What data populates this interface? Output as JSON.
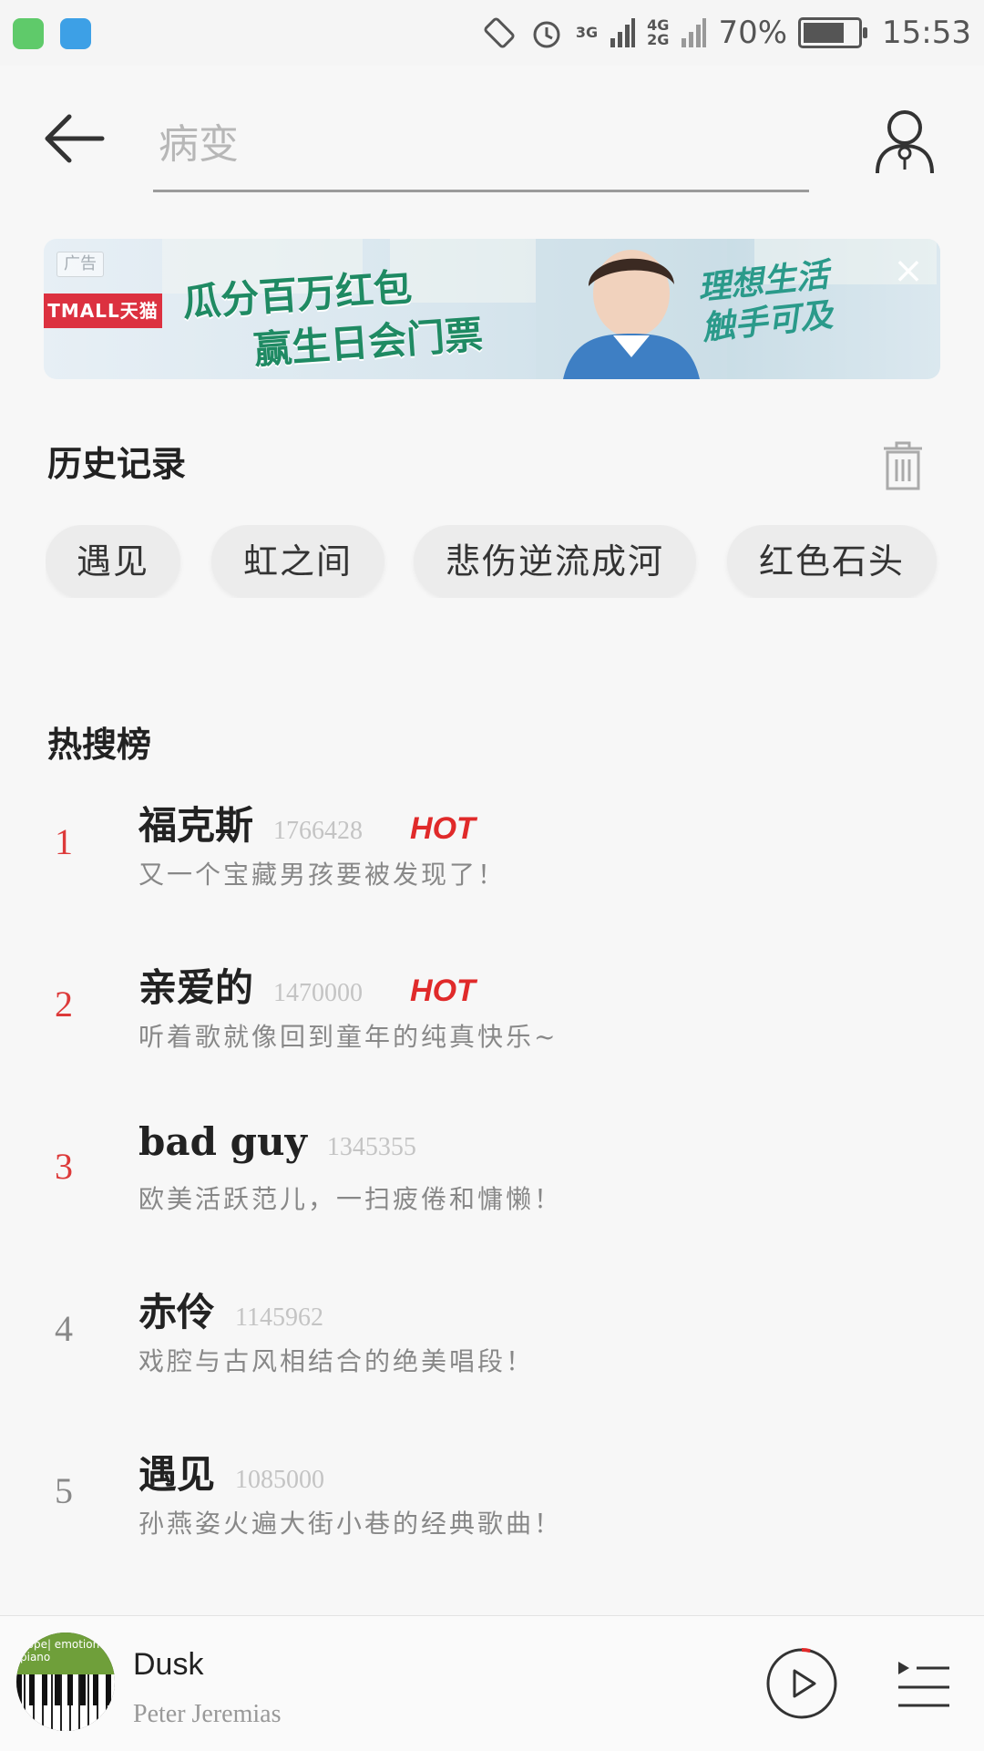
{
  "status_bar": {
    "battery": "70%",
    "time": "15:53",
    "net1": "3G",
    "net2": "4G",
    "net3": "2G",
    "icons": [
      "message-app-icon",
      "browser-app-icon",
      "rotate-icon",
      "alarm-icon",
      "signal-icon",
      "battery-icon"
    ]
  },
  "search": {
    "placeholder": "病变"
  },
  "ad": {
    "tag": "广告",
    "brand": "TMALL天猫",
    "headline1": "瓜分百万红包",
    "headline2": "赢生日会门票",
    "slogan": "理想生活\n触手可及"
  },
  "history": {
    "title": "历史记录",
    "items": [
      "遇见",
      "虹之间",
      "悲伤逆流成河",
      "红色石头"
    ]
  },
  "hot": {
    "title": "热搜榜",
    "items": [
      {
        "rank": "1",
        "name": "福克斯",
        "count": "1766428",
        "badge": "HOT",
        "desc": "又一个宝藏男孩要被发现了！"
      },
      {
        "rank": "2",
        "name": "亲爱的",
        "count": "1470000",
        "badge": "HOT",
        "desc": "听着歌就像回到童年的纯真快乐~"
      },
      {
        "rank": "3",
        "name": "bad guy",
        "count": "1345355",
        "badge": "",
        "desc": "欧美活跃范儿，一扫疲倦和慵懒！"
      },
      {
        "rank": "4",
        "name": "赤伶",
        "count": "1145962",
        "badge": "",
        "desc": "戏腔与古风相结合的绝美唱段！"
      },
      {
        "rank": "5",
        "name": "遇见",
        "count": "1085000",
        "badge": "",
        "desc": "孙燕姿火遍大街小巷的经典歌曲！"
      }
    ]
  },
  "player": {
    "cover_text": "hope| emotional piano",
    "title": "Dusk",
    "artist": "Peter Jeremias",
    "progress": 0.04
  },
  "colors": {
    "accent": "#dd3a3a",
    "hot": "#e02a2a"
  }
}
